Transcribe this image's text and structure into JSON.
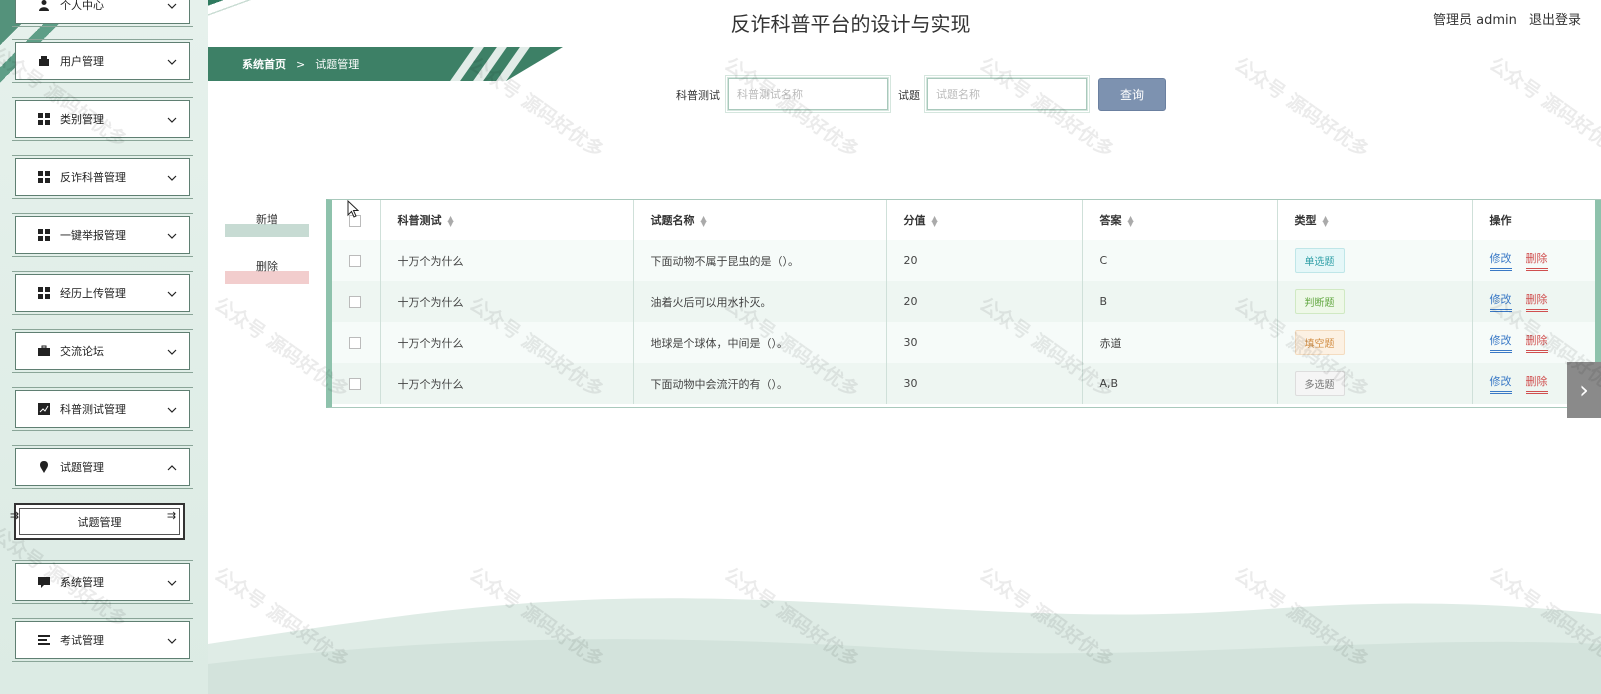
{
  "header": {
    "title": "反诈科普平台的设计与实现",
    "user": "管理员 admin",
    "logout": "退出登录"
  },
  "sidebar": {
    "items": [
      {
        "label": "个人中心",
        "icon": "person-icon"
      },
      {
        "label": "用户管理",
        "icon": "wallet-icon"
      },
      {
        "label": "类别管理",
        "icon": "grid-icon"
      },
      {
        "label": "反诈科普管理",
        "icon": "grid-icon"
      },
      {
        "label": "一键举报管理",
        "icon": "grid-icon"
      },
      {
        "label": "经历上传管理",
        "icon": "grid-icon"
      },
      {
        "label": "交流论坛",
        "icon": "briefcase-icon"
      },
      {
        "label": "科普测试管理",
        "icon": "chart-icon"
      },
      {
        "label": "试题管理",
        "icon": "pin-icon",
        "expanded": true
      },
      {
        "label": "系统管理",
        "icon": "chat-icon"
      },
      {
        "label": "考试管理",
        "icon": "list-icon"
      }
    ],
    "submenu": {
      "label": "试题管理"
    }
  },
  "breadcrumb": {
    "home": "系统首页",
    "separator": ">",
    "current": "试题管理"
  },
  "search": {
    "field1_label": "科普测试",
    "field1_placeholder": "科普测试名称",
    "field2_label": "试题",
    "field2_placeholder": "试题名称",
    "button": "查询"
  },
  "actions": {
    "add": "新增",
    "delete": "删除"
  },
  "table": {
    "columns": [
      "科普测试",
      "试题名称",
      "分值",
      "答案",
      "类型",
      "操作"
    ],
    "rows": [
      {
        "test": "十万个为什么",
        "question": "下面动物不属于昆虫的是（）。",
        "score": "20",
        "answer": "C",
        "type": "单选题",
        "type_key": "single"
      },
      {
        "test": "十万个为什么",
        "question": "油着火后可以用水扑灭。",
        "score": "20",
        "answer": "B",
        "type": "判断题",
        "type_key": "judge"
      },
      {
        "test": "十万个为什么",
        "question": "地球是个球体，中间是（）。",
        "score": "30",
        "answer": "赤道",
        "type": "填空题",
        "type_key": "fill"
      },
      {
        "test": "十万个为什么",
        "question": "下面动物中会流汗的有（）。",
        "score": "30",
        "answer": "A,B",
        "type": "多选题",
        "type_key": "multi"
      }
    ],
    "edit_label": "修改",
    "delete_label": "删除"
  },
  "watermark": "公众号 源码好优多",
  "colors": {
    "primary": "#3d8066",
    "query_button": "#7d92b0",
    "edit": "#3a79c6",
    "delete": "#d04f4f"
  }
}
